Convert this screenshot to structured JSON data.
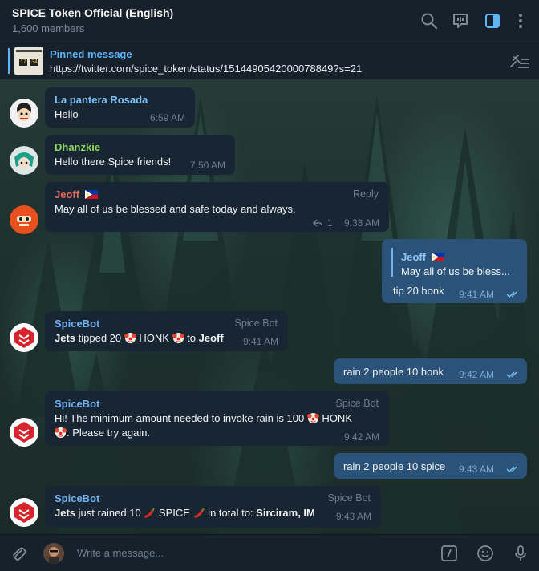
{
  "header": {
    "title": "SPICE Token Official (English)",
    "members": "1,600 members",
    "icons": [
      "search-icon",
      "live-stream-icon",
      "sidebar-icon",
      "more-icon"
    ]
  },
  "pinned": {
    "label": "Pinned message",
    "text": "https://twitter.com/spice_token/status/1514490542000078849?s=21",
    "thumb_digits": [
      "17",
      "34"
    ]
  },
  "messages": [
    {
      "sender": "La pantera Rosada",
      "text": "Hello",
      "time": "6:59 AM"
    },
    {
      "sender": "Dhanzkie",
      "text": "Hello there Spice friends!",
      "time": "7:50 AM"
    },
    {
      "sender": "Jeoff",
      "text": "May all of us be blessed and safe today and always.",
      "time": "9:33 AM",
      "reply_label": "Reply",
      "reply_count": "1"
    },
    {
      "reply_to_name": "Jeoff",
      "reply_to_text": "May all of us be bless...",
      "text": "tip 20 honk",
      "time": "9:41 AM"
    },
    {
      "sender": "SpiceBot",
      "tag": "Spice Bot",
      "bold1": "Jets",
      "part1": " tipped 20 ",
      "part2": " HONK ",
      "part3": " to ",
      "bold2": "Jeoff",
      "time": "9:41 AM"
    },
    {
      "text": "rain 2 people 10 honk",
      "time": "9:42 AM"
    },
    {
      "sender": "SpiceBot",
      "tag": "Spice Bot",
      "line1": "Hi! The minimum amount needed to invoke rain is 100 ",
      "line1b": " HONK",
      "line2": ". Please try again.",
      "time": "9:42 AM"
    },
    {
      "text": "rain 2 people 10 spice",
      "time": "9:43 AM"
    },
    {
      "sender": "SpiceBot",
      "tag": "Spice Bot",
      "bold1": "Jets",
      "part1": " just rained 10 ",
      "part2": " SPICE ",
      "part3": " in total to: ",
      "bold2": "Sirciram, IM",
      "time": "9:43 AM"
    }
  ],
  "composer": {
    "placeholder": "Write a message..."
  },
  "colors": {
    "accent": "#5eb5f7",
    "incoming_bubble": "#182533",
    "outgoing_bubble": "#2b5278",
    "name_pantera": "#7bc1f5",
    "name_dhanzkie": "#8fd468",
    "name_jeoff": "#e96a59",
    "name_spicebot": "#6fb2f0"
  }
}
